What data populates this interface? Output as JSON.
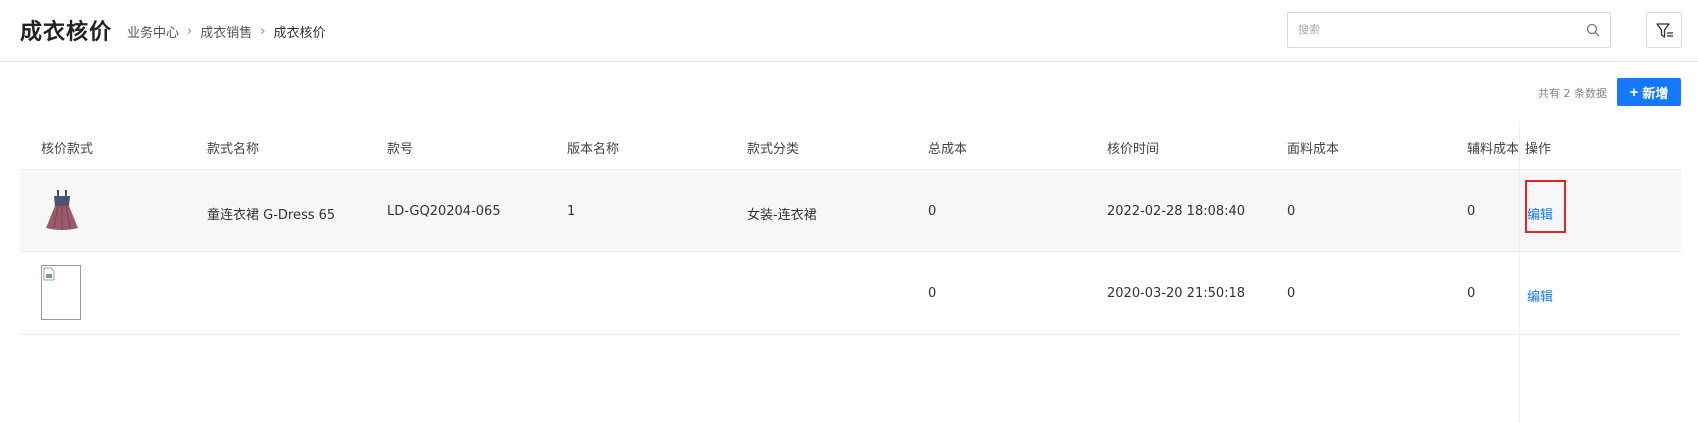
{
  "header": {
    "title": "成衣核价",
    "breadcrumb": [
      "业务中心",
      "成衣销售",
      "成衣核价"
    ],
    "search_placeholder": "搜索"
  },
  "toolbar": {
    "count_text": "共有 2 条数据",
    "add_label": "新增"
  },
  "table": {
    "columns": [
      "核价款式",
      "款式名称",
      "款号",
      "版本名称",
      "款式分类",
      "总成本",
      "核价时间",
      "面料成本",
      "辅料成本",
      "操作"
    ],
    "rows": [
      {
        "image": "dress-thumbnail",
        "style_name": "童连衣裙 G-Dress 65",
        "style_no": "LD-GQ20204-065",
        "version": "1",
        "category": "女装-连衣裙",
        "total_cost": "0",
        "pricing_time": "2022-02-28 18:08:40",
        "fabric_cost": "0",
        "accessory_cost": "0",
        "action": "编辑"
      },
      {
        "image": "broken-image",
        "style_name": "",
        "style_no": "",
        "version": "",
        "category": "",
        "total_cost": "0",
        "pricing_time": "2020-03-20 21:50:18",
        "fabric_cost": "0",
        "accessory_cost": "0",
        "action": "编辑"
      }
    ]
  },
  "colors": {
    "primary": "#1677ff",
    "highlight": "#e32424",
    "row_highlight": "#f7f7f7"
  }
}
